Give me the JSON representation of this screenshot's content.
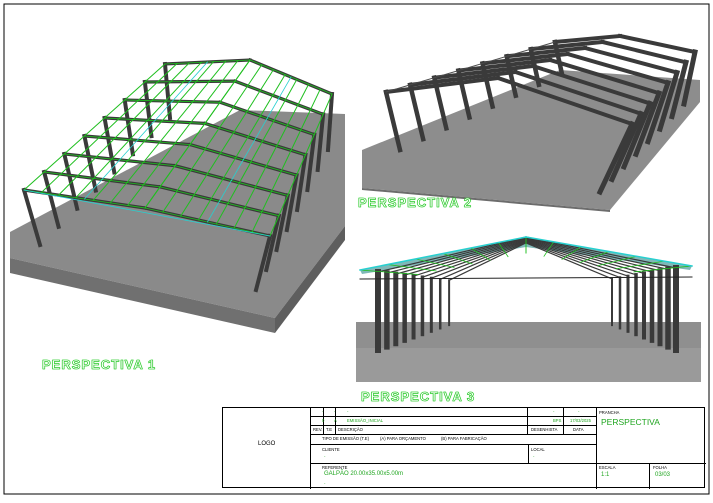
{
  "views": {
    "p1": {
      "label": "PERSPECTIVA 1"
    },
    "p2": {
      "label": "PERSPECTIVA 2"
    },
    "p3": {
      "label": "PERSPECTIVA 3"
    }
  },
  "title_block": {
    "logo": "LOGO",
    "rev_row": [
      "0",
      "A",
      "EMISSÃO_INICIAL",
      "BPS",
      "17/03/2025"
    ],
    "rev_dashes": [
      "-",
      "-",
      "-",
      "-",
      "-"
    ],
    "headers": {
      "rev": "REV.",
      "tipo": "T.E",
      "descricao": "DESCRIÇÃO",
      "desenhista": "DESENHISTA",
      "data": "DATA"
    },
    "tipo_emissao": "TIPO DE EMISSÃO (T.E)",
    "option_a": "(A) PARA ORÇAMENTO",
    "option_b": "(B) PARA FABRICAÇÃO",
    "cliente_label": "CLIENTE",
    "cliente_value": "-",
    "local_label": "LOCAL",
    "local_value": "-",
    "referente_label": "REFERENTE",
    "referente_value": "GALPÃO 20.00x35.00x5.00m",
    "referente_extra": "-",
    "prancha_label": "PRANCHA",
    "prancha_value": "PERSPECTIVA",
    "escala_label": "ESCALA",
    "escala_value": "1:1",
    "folha_label": "FOLHA",
    "folha_value": "03/03"
  },
  "colors": {
    "frame": "#000000",
    "steel": "#3a3a3a",
    "floor_top": "#8c8c8c",
    "floor_side": "#6e6e6e",
    "purlin": "#1fbf1f",
    "bracing": "#27d0d0",
    "label": "#17c317"
  }
}
